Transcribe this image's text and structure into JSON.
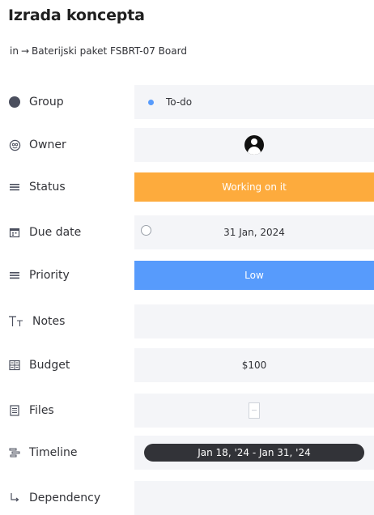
{
  "header": {
    "title": "Izrada koncepta",
    "breadcrumb_prefix": "in",
    "breadcrumb_arrow": "→",
    "breadcrumb_board": "Baterijski paket FSBRT-07 Board"
  },
  "fields": [
    {
      "label": "Group",
      "icon": "group-dot-icon",
      "value": "To-do",
      "dot_color": "#579bfc"
    },
    {
      "label": "Owner",
      "icon": "owner-icon",
      "value": ""
    },
    {
      "label": "Status",
      "icon": "status-icon",
      "value": "Working on it",
      "color": "#fdab3d"
    },
    {
      "label": "Due date",
      "icon": "calendar-icon",
      "value": "31 Jan, 2024"
    },
    {
      "label": "Priority",
      "icon": "priority-icon",
      "value": "Low",
      "color": "#579bfc"
    },
    {
      "label": "Notes",
      "icon": "text-icon",
      "value": ""
    },
    {
      "label": "Budget",
      "icon": "numbers-icon",
      "value": "$100"
    },
    {
      "label": "Files",
      "icon": "file-icon",
      "value": ""
    },
    {
      "label": "Timeline",
      "icon": "timeline-icon",
      "value": "Jan 18, '24 - Jan 31, '24"
    },
    {
      "label": "Dependency",
      "icon": "dependency-icon",
      "value": ""
    }
  ]
}
